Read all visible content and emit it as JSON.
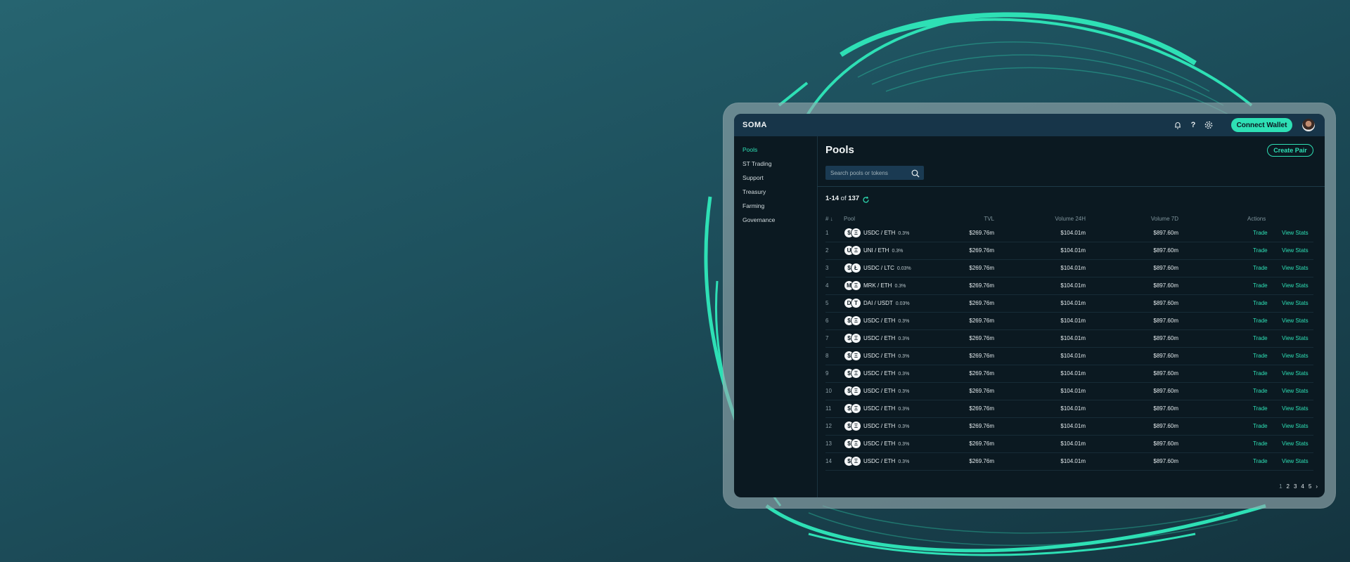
{
  "app": {
    "brand": "SOMA"
  },
  "header": {
    "connect_label": "Connect Wallet"
  },
  "sidebar": {
    "items": [
      {
        "label": "Pools",
        "active": true
      },
      {
        "label": "ST Trading"
      },
      {
        "label": "Support"
      },
      {
        "label": "Treasury"
      },
      {
        "label": "Farming"
      },
      {
        "label": "Governance"
      }
    ]
  },
  "main": {
    "title": "Pools",
    "create_label": "Create Pair",
    "search_placeholder": "Search pools or tokens",
    "count_range": "1-14",
    "count_of": "of",
    "count_total": "137"
  },
  "table": {
    "headers": [
      "# ↓",
      "Pool",
      "TVL",
      "Volume 24H",
      "Volume 7D",
      "Actions"
    ],
    "action_trade": "Trade",
    "action_stats": "View Stats",
    "rows": [
      {
        "n": "1",
        "pair": "USDC / ETH",
        "fee": "0.3%",
        "t1": "$",
        "t2": "Ξ",
        "tvl": "$269.76m",
        "v24": "$104.01m",
        "v7": "$897.60m"
      },
      {
        "n": "2",
        "pair": "UNI / ETH",
        "fee": "0.3%",
        "t1": "U",
        "t2": "Ξ",
        "tvl": "$269.76m",
        "v24": "$104.01m",
        "v7": "$897.60m"
      },
      {
        "n": "3",
        "pair": "USDC / LTC",
        "fee": "0.03%",
        "t1": "$",
        "t2": "Ł",
        "tvl": "$269.76m",
        "v24": "$104.01m",
        "v7": "$897.60m"
      },
      {
        "n": "4",
        "pair": "MRK / ETH",
        "fee": "0.3%",
        "t1": "M",
        "t2": "Ξ",
        "tvl": "$269.76m",
        "v24": "$104.01m",
        "v7": "$897.60m"
      },
      {
        "n": "5",
        "pair": "DAI / USDT",
        "fee": "0.03%",
        "t1": "D",
        "t2": "T",
        "tvl": "$269.76m",
        "v24": "$104.01m",
        "v7": "$897.60m"
      },
      {
        "n": "6",
        "pair": "USDC / ETH",
        "fee": "0.3%",
        "t1": "$",
        "t2": "Ξ",
        "tvl": "$269.76m",
        "v24": "$104.01m",
        "v7": "$897.60m"
      },
      {
        "n": "7",
        "pair": "USDC / ETH",
        "fee": "0.3%",
        "t1": "$",
        "t2": "Ξ",
        "tvl": "$269.76m",
        "v24": "$104.01m",
        "v7": "$897.60m"
      },
      {
        "n": "8",
        "pair": "USDC / ETH",
        "fee": "0.3%",
        "t1": "$",
        "t2": "Ξ",
        "tvl": "$269.76m",
        "v24": "$104.01m",
        "v7": "$897.60m"
      },
      {
        "n": "9",
        "pair": "USDC / ETH",
        "fee": "0.3%",
        "t1": "$",
        "t2": "Ξ",
        "tvl": "$269.76m",
        "v24": "$104.01m",
        "v7": "$897.60m"
      },
      {
        "n": "10",
        "pair": "USDC / ETH",
        "fee": "0.3%",
        "t1": "$",
        "t2": "Ξ",
        "tvl": "$269.76m",
        "v24": "$104.01m",
        "v7": "$897.60m"
      },
      {
        "n": "11",
        "pair": "USDC / ETH",
        "fee": "0.3%",
        "t1": "$",
        "t2": "Ξ",
        "tvl": "$269.76m",
        "v24": "$104.01m",
        "v7": "$897.60m"
      },
      {
        "n": "12",
        "pair": "USDC / ETH",
        "fee": "0.3%",
        "t1": "$",
        "t2": "Ξ",
        "tvl": "$269.76m",
        "v24": "$104.01m",
        "v7": "$897.60m"
      },
      {
        "n": "13",
        "pair": "USDC / ETH",
        "fee": "0.3%",
        "t1": "$",
        "t2": "Ξ",
        "tvl": "$269.76m",
        "v24": "$104.01m",
        "v7": "$897.60m"
      },
      {
        "n": "14",
        "pair": "USDC / ETH",
        "fee": "0.3%",
        "t1": "$",
        "t2": "Ξ",
        "tvl": "$269.76m",
        "v24": "$104.01m",
        "v7": "$897.60m"
      }
    ]
  },
  "pagination": {
    "pages": [
      "1",
      "2",
      "3",
      "4",
      "5"
    ],
    "next": "›"
  },
  "colors": {
    "accent": "#2ee0b5",
    "panel": "#0b1921",
    "topbar": "#173549"
  },
  "icons": [
    "bell-icon",
    "help-icon",
    "gear-icon",
    "search-icon",
    "refresh-icon"
  ]
}
